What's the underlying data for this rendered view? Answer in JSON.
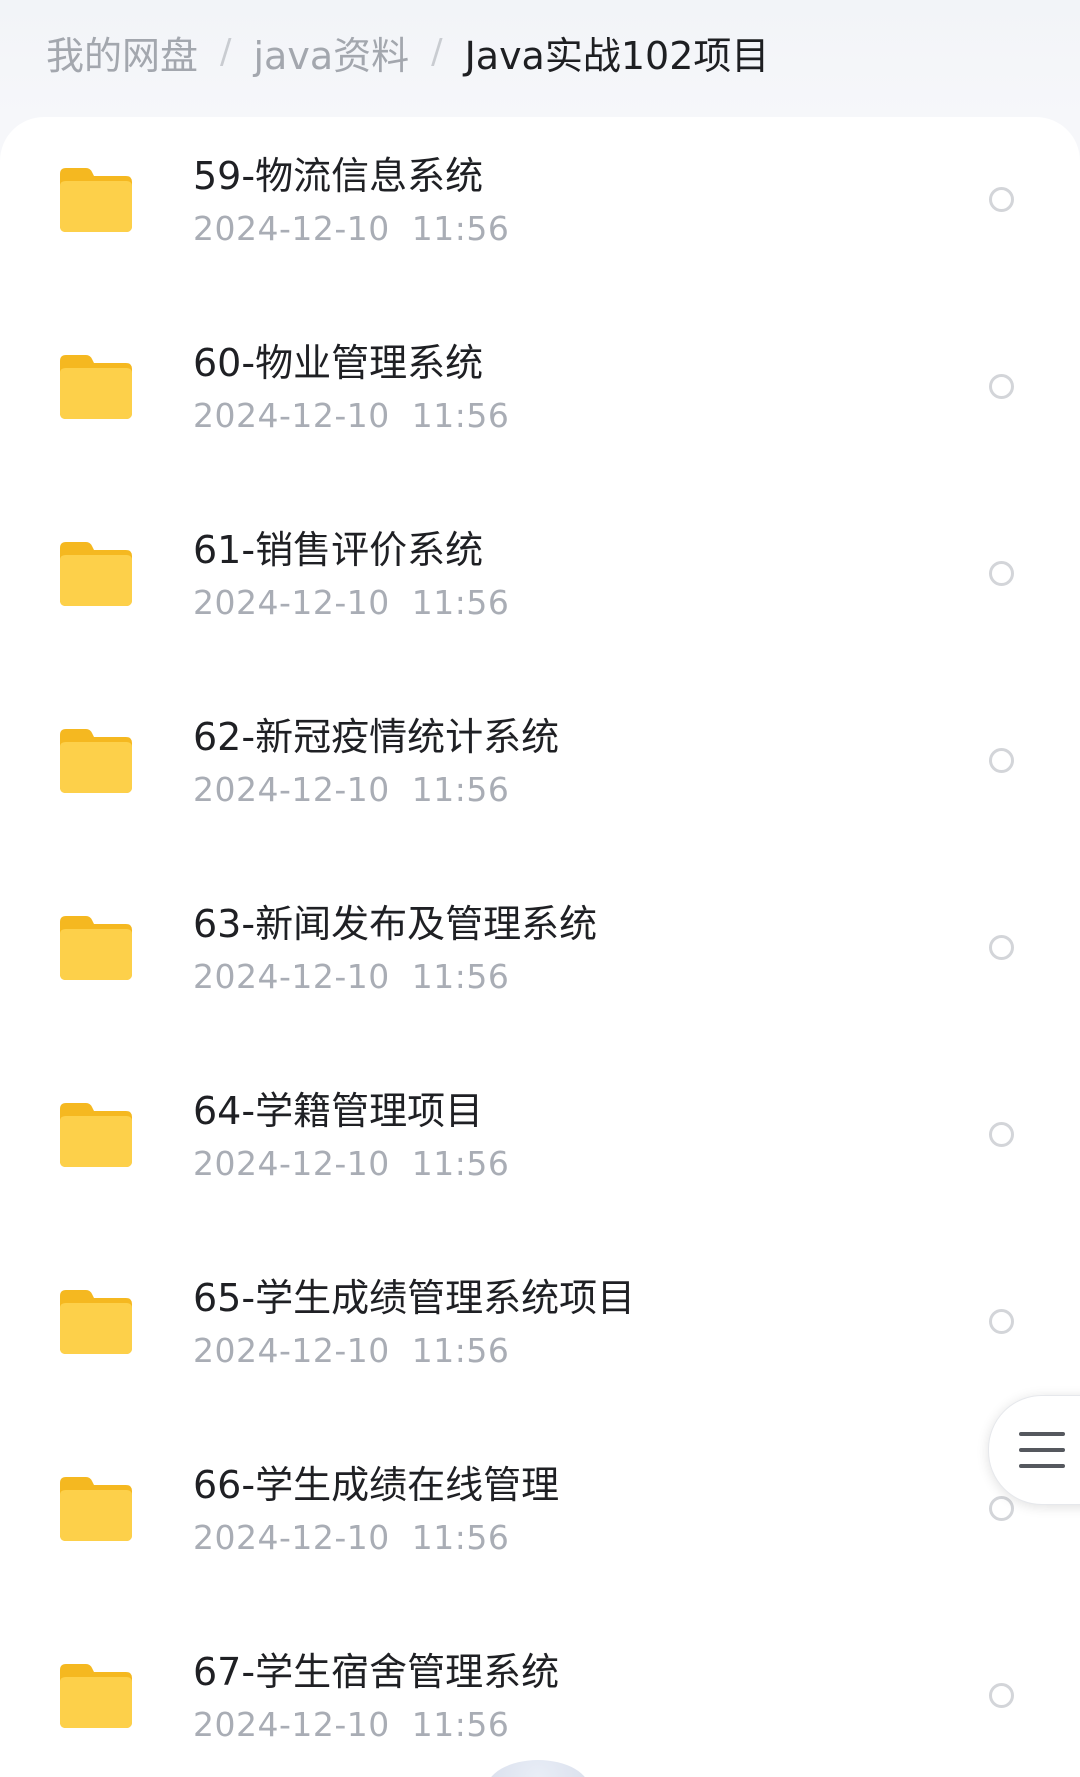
{
  "breadcrumb": [
    {
      "label": "我的网盘"
    },
    {
      "label": "java资料"
    },
    {
      "label": "Java实战102项目"
    }
  ],
  "breadcrumb_separator": "/",
  "colors": {
    "folder": "#fcc83a",
    "background": "#f3f5f8",
    "panel": "#ffffff"
  },
  "folders": [
    {
      "name": "59-物流信息系统",
      "date": "2024-12-10  11:56"
    },
    {
      "name": "60-物业管理系统",
      "date": "2024-12-10  11:56"
    },
    {
      "name": "61-销售评价系统",
      "date": "2024-12-10  11:56"
    },
    {
      "name": "62-新冠疫情统计系统",
      "date": "2024-12-10  11:56"
    },
    {
      "name": "63-新闻发布及管理系统",
      "date": "2024-12-10  11:56"
    },
    {
      "name": "64-学籍管理项目",
      "date": "2024-12-10  11:56"
    },
    {
      "name": "65-学生成绩管理系统项目",
      "date": "2024-12-10  11:56"
    },
    {
      "name": "66-学生成绩在线管理",
      "date": "2024-12-10  11:56"
    },
    {
      "name": "67-学生宿舍管理系统",
      "date": "2024-12-10  11:56"
    }
  ],
  "icons": {
    "row": "folder-icon",
    "select": "radio-circle-icon",
    "menu": "hamburger-menu-icon"
  }
}
